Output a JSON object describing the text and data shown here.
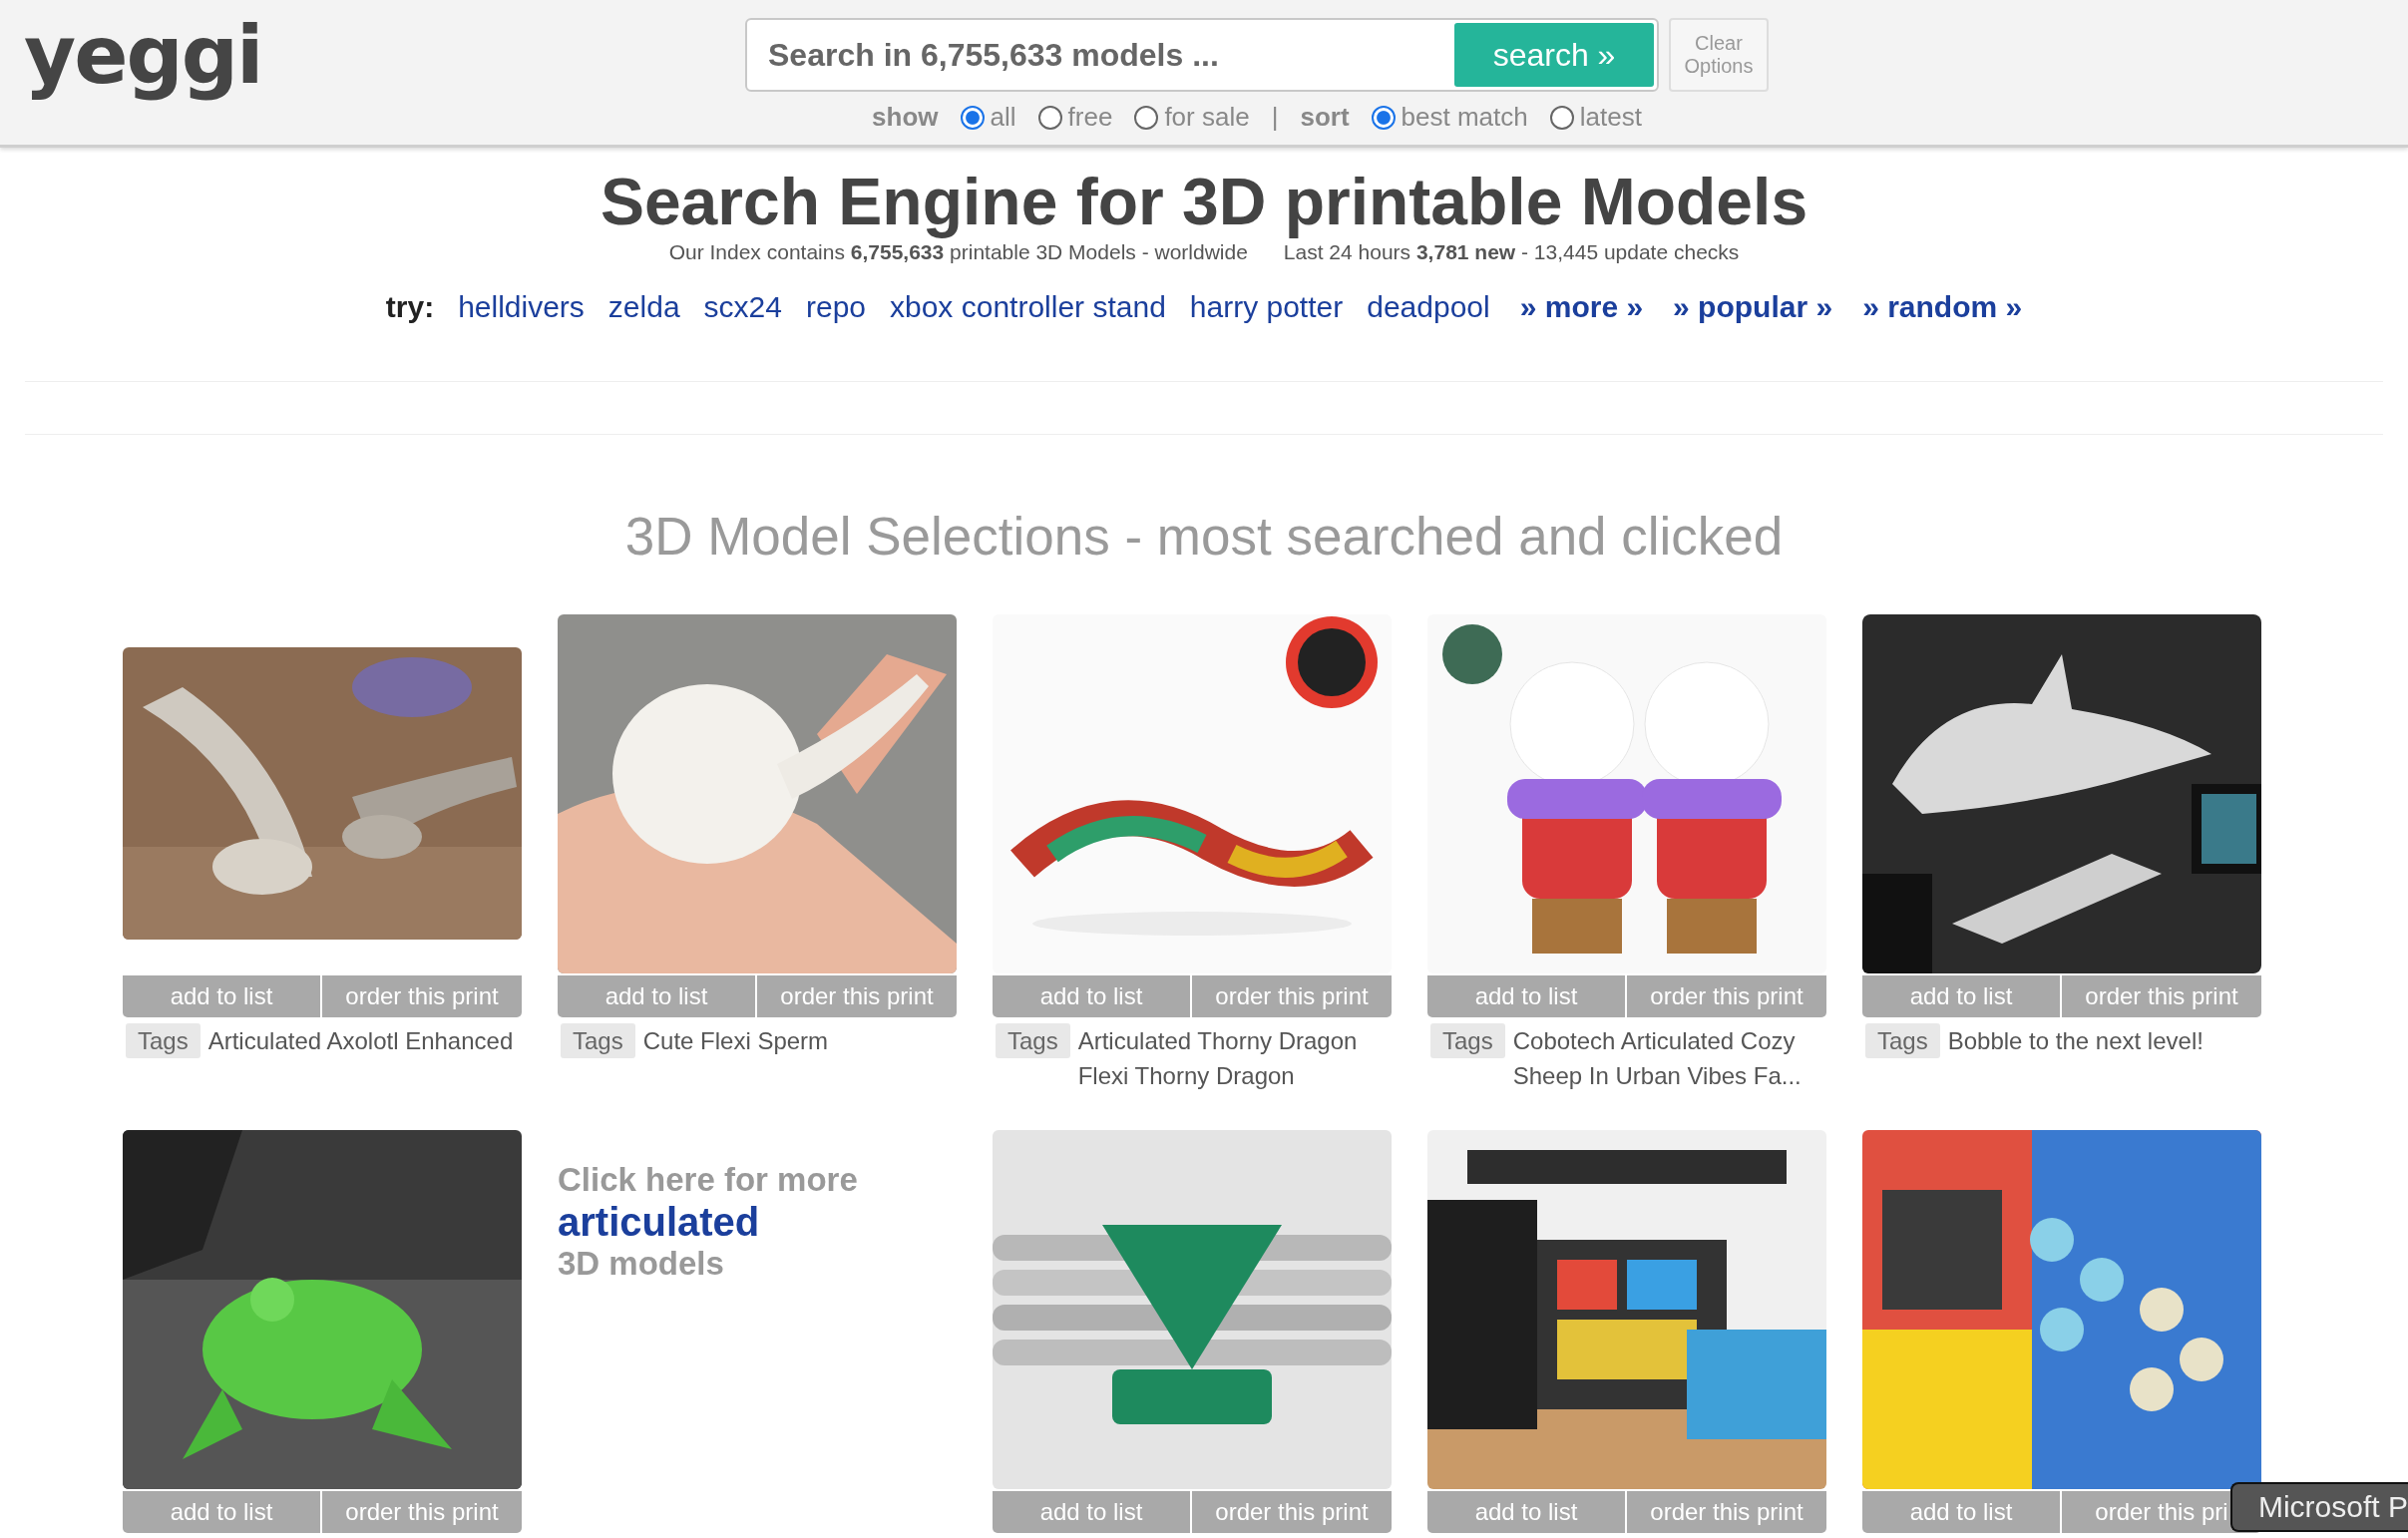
{
  "header": {
    "logo": "yeggi",
    "search": {
      "placeholder": "Search in 6,755,633 models ...",
      "button": "search »"
    },
    "clear_button": [
      "Clear",
      "Options"
    ],
    "show": {
      "label": "show",
      "options": [
        {
          "label": "all",
          "selected": true
        },
        {
          "label": "free",
          "selected": false
        },
        {
          "label": "for sale",
          "selected": false
        }
      ]
    },
    "separator": "|",
    "sort": {
      "label": "sort",
      "options": [
        {
          "label": "best match",
          "selected": true
        },
        {
          "label": "latest",
          "selected": false
        }
      ]
    }
  },
  "hero": {
    "title": "Search Engine for 3D printable Models",
    "stats": [
      "Our Index contains **6,755,633** printable 3D Models - worldwide",
      "Last 24 hours **3,781 new** - 13,445 update checks"
    ],
    "try_label": "try:",
    "try_links": [
      {
        "label": "helldivers",
        "kind": "term"
      },
      {
        "label": "zelda",
        "kind": "term"
      },
      {
        "label": "scx24",
        "kind": "term"
      },
      {
        "label": "repo",
        "kind": "term"
      },
      {
        "label": "xbox controller stand",
        "kind": "term"
      },
      {
        "label": "harry potter",
        "kind": "term"
      },
      {
        "label": "deadpool",
        "kind": "term"
      },
      {
        "label": "» more »",
        "kind": "nav"
      },
      {
        "label": "» popular »",
        "kind": "nav"
      },
      {
        "label": "» random »",
        "kind": "nav"
      }
    ]
  },
  "section_title": "3D Model Selections - most searched and clicked",
  "cards": [
    {
      "kind": "model",
      "image": {
        "kind": "picture"
      },
      "buttons": [
        "add to list",
        "order this print"
      ],
      "tag_label": "Tags",
      "title": "Articulated Axolotl Enhanced"
    },
    {
      "kind": "model",
      "image": {
        "kind": "picture"
      },
      "buttons": [
        "add to list",
        "order this print"
      ],
      "tag_label": "Tags",
      "title": "Cute Flexi Sperm"
    },
    {
      "kind": "model",
      "image": {
        "kind": "picture"
      },
      "buttons": [
        "add to list",
        "order this print"
      ],
      "tag_label": "Tags",
      "title": "Articulated Thorny Dragon Flexi Thorny Dragon"
    },
    {
      "kind": "model",
      "image": {
        "kind": "picture"
      },
      "buttons": [
        "add to list",
        "order this print"
      ],
      "tag_label": "Tags",
      "title": "Cobotech Articulated Cozy Sheep In Urban Vibes Fa..."
    },
    {
      "kind": "model",
      "image": {
        "kind": "picture"
      },
      "buttons": [
        "add to list",
        "order this print"
      ],
      "tag_label": "Tags",
      "title": "Bobble to the next level!"
    },
    {
      "kind": "model",
      "image": {
        "kind": "picture"
      },
      "buttons": [
        "add to list",
        "order this print"
      ]
    },
    {
      "kind": "promo",
      "lines": [
        "Click here for more",
        "articulated",
        "3D models"
      ]
    },
    {
      "kind": "model",
      "image": {
        "kind": "picture"
      },
      "buttons": [
        "add to list",
        "order this print"
      ]
    },
    {
      "kind": "model",
      "image": {
        "kind": "picture"
      },
      "buttons": [
        "add to list",
        "order this print"
      ]
    },
    {
      "kind": "model",
      "image": {
        "kind": "picture"
      },
      "buttons": [
        "add to list",
        "order this pri"
      ]
    }
  ],
  "tooltip": "Microsoft P"
}
